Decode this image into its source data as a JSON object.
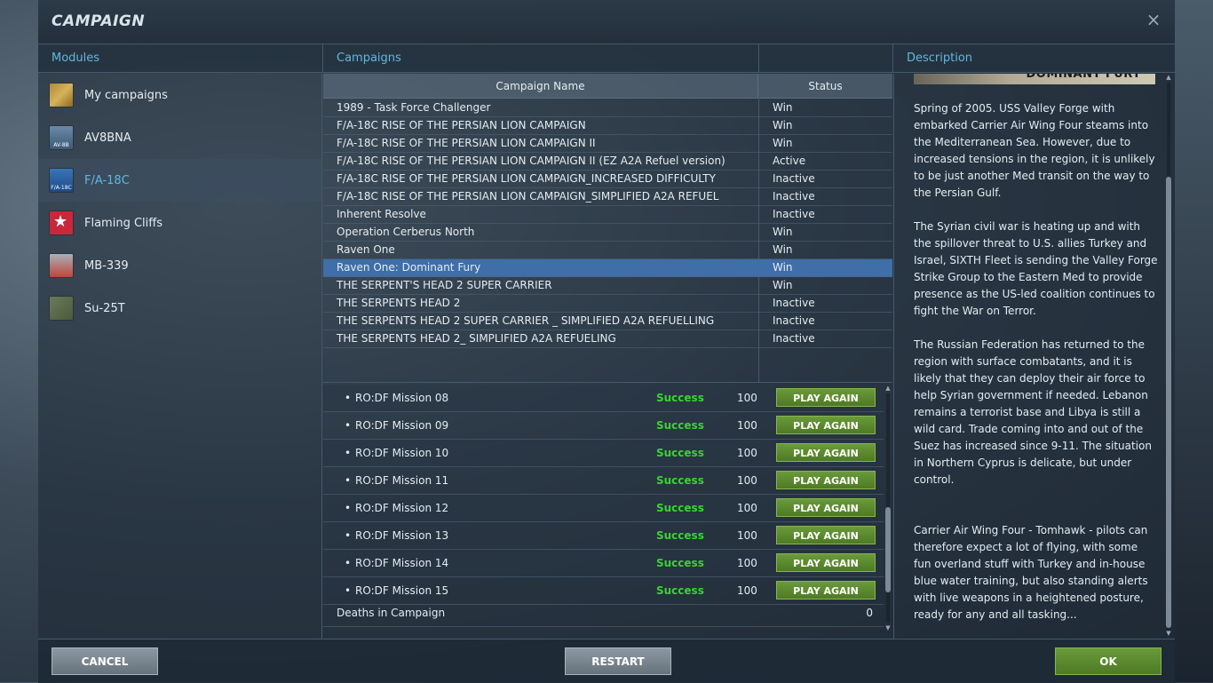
{
  "window": {
    "title": "CAMPAIGN",
    "close_icon": "×"
  },
  "columns": {
    "modules": "Modules",
    "campaigns": "Campaigns",
    "description": "Description"
  },
  "modules": [
    {
      "label": "My campaigns",
      "icon": "my-campaigns-icon",
      "selected": false
    },
    {
      "label": "AV8BNA",
      "icon": "av8bna-icon",
      "selected": false
    },
    {
      "label": "F/A-18C",
      "icon": "fa18c-icon",
      "selected": true
    },
    {
      "label": "Flaming Cliffs",
      "icon": "flaming-cliffs-icon",
      "selected": false
    },
    {
      "label": "MB-339",
      "icon": "mb339-icon",
      "selected": false
    },
    {
      "label": "Su-25T",
      "icon": "su25t-icon",
      "selected": false
    }
  ],
  "campaigns_table": {
    "headers": {
      "name": "Campaign Name",
      "status": "Status"
    },
    "rows": [
      {
        "name": "1989 - Task Force Challenger",
        "status": "Win"
      },
      {
        "name": "F/A-18C RISE OF THE PERSIAN LION CAMPAIGN",
        "status": "Win"
      },
      {
        "name": "F/A-18C RISE OF THE PERSIAN LION CAMPAIGN II",
        "status": "Win"
      },
      {
        "name": "F/A-18C RISE OF THE PERSIAN LION CAMPAIGN II (EZ A2A Refuel version)",
        "status": "Active"
      },
      {
        "name": "F/A-18C RISE OF THE PERSIAN LION CAMPAIGN_INCREASED DIFFICULTY",
        "status": "Inactive"
      },
      {
        "name": "F/A-18C RISE OF THE PERSIAN LION CAMPAIGN_SIMPLIFIED A2A REFUEL",
        "status": "Inactive"
      },
      {
        "name": "Inherent Resolve",
        "status": "Inactive"
      },
      {
        "name": "Operation Cerberus North",
        "status": "Win"
      },
      {
        "name": "Raven One",
        "status": "Win"
      },
      {
        "name": "Raven One: Dominant Fury",
        "status": "Win",
        "selected": true
      },
      {
        "name": "THE SERPENT'S HEAD 2 SUPER CARRIER",
        "status": "Win"
      },
      {
        "name": "THE SERPENTS HEAD 2",
        "status": "Inactive"
      },
      {
        "name": "THE SERPENTS HEAD 2 SUPER CARRIER _ SIMPLIFIED A2A REFUELLING",
        "status": "Inactive"
      },
      {
        "name": "THE SERPENTS HEAD 2_ SIMPLIFIED A2A REFUELING",
        "status": "Inactive"
      }
    ]
  },
  "missions": [
    {
      "name": "RO:DF Mission 08",
      "result": "Success",
      "score": "100",
      "button": "PLAY AGAIN"
    },
    {
      "name": "RO:DF Mission 09",
      "result": "Success",
      "score": "100",
      "button": "PLAY AGAIN"
    },
    {
      "name": "RO:DF Mission 10",
      "result": "Success",
      "score": "100",
      "button": "PLAY AGAIN"
    },
    {
      "name": "RO:DF Mission 11",
      "result": "Success",
      "score": "100",
      "button": "PLAY AGAIN"
    },
    {
      "name": "RO:DF Mission 12",
      "result": "Success",
      "score": "100",
      "button": "PLAY AGAIN"
    },
    {
      "name": "RO:DF Mission 13",
      "result": "Success",
      "score": "100",
      "button": "PLAY AGAIN"
    },
    {
      "name": "RO:DF Mission 14",
      "result": "Success",
      "score": "100",
      "button": "PLAY AGAIN"
    },
    {
      "name": "RO:DF Mission 15",
      "result": "Success",
      "score": "100",
      "button": "PLAY AGAIN"
    }
  ],
  "deaths": {
    "label": "Deaths in Campaign",
    "value": "0"
  },
  "description": {
    "banner_text": "DOMINANT FURY",
    "paragraphs": [
      "Spring of 2005. USS Valley Forge with embarked Carrier Air Wing Four steams into the Mediterranean Sea. However, due to increased tensions in the region, it is unlikely to be just another Med transit on the way to the Persian Gulf.",
      "The Syrian civil war is heating up and with the spillover threat to U.S. allies Turkey and Israel,  SIXTH Fleet is sending the Valley Forge Strike Group to the Eastern Med to provide presence as the US-led coalition continues to fight the War on Terror.",
      "The Russian Federation has returned to the region with surface combatants, and it is likely that they can deploy their air force to help Syrian government if needed. Lebanon remains a terrorist base and Libya is still a wild card. Trade coming into and out of the Suez has increased since 9-11. The situation in Northern Cyprus is delicate, but under control.",
      "Carrier Air Wing Four - Tomhawk - pilots can therefore expect a lot of flying, with some fun overland stuff with Turkey and in-house blue water training, but also standing alerts with live weapons in a heightened posture, ready for any and all tasking..."
    ]
  },
  "footer": {
    "cancel": "CANCEL",
    "restart": "RESTART",
    "ok": "OK"
  },
  "colors": {
    "accent": "#5fb8e0",
    "success": "#38d430",
    "selected_row": "#3f6ea8",
    "ok_button": "#5a8a2e"
  }
}
